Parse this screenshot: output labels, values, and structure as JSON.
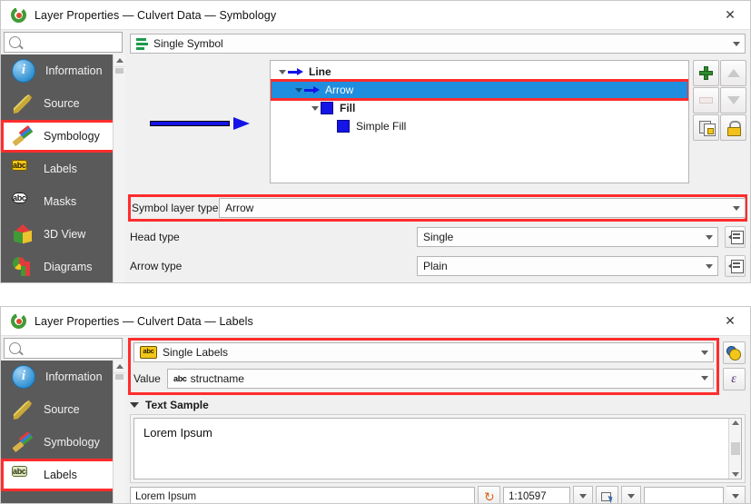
{
  "windows": {
    "symbology": {
      "title": "Layer Properties — Culvert Data — Symbology",
      "close_label": "✕",
      "search_placeholder": "",
      "search_value": "",
      "sidebar": [
        {
          "label": "Information",
          "icon": "info-icon",
          "active": false
        },
        {
          "label": "Source",
          "icon": "source-icon",
          "active": false
        },
        {
          "label": "Symbology",
          "icon": "symbology-brush-icon",
          "active": true
        },
        {
          "label": "Labels",
          "icon": "labels-abc-icon",
          "active": false
        },
        {
          "label": "Masks",
          "icon": "masks-abc-icon",
          "active": false
        },
        {
          "label": "3D View",
          "icon": "cube-3d-icon",
          "active": false
        },
        {
          "label": "Diagrams",
          "icon": "diagrams-chart-icon",
          "active": false
        }
      ],
      "renderer": {
        "label": "Single Symbol",
        "icon": "symbol-bars-icon"
      },
      "tree": [
        {
          "label": "Line",
          "indent": 0,
          "icon": "arrow-icon",
          "bold": true,
          "selected": false
        },
        {
          "label": "Arrow",
          "indent": 1,
          "icon": "arrow-icon",
          "bold": false,
          "selected": true
        },
        {
          "label": "Fill",
          "indent": 2,
          "icon": "color-swatch",
          "bold": true,
          "selected": false
        },
        {
          "label": "Simple Fill",
          "indent": 3,
          "icon": "color-swatch",
          "bold": false,
          "selected": false
        }
      ],
      "tree_buttons": [
        {
          "name": "add-symbol-layer-button",
          "icon": "plus-icon"
        },
        {
          "name": "move-up-button",
          "icon": "triangle-up-icon"
        },
        {
          "name": "remove-symbol-layer-button",
          "icon": "minus-icon"
        },
        {
          "name": "move-down-button",
          "icon": "triangle-down-icon"
        },
        {
          "name": "duplicate-button",
          "icon": "duplicate-icon"
        },
        {
          "name": "lock-button",
          "icon": "lock-icon"
        }
      ],
      "properties": [
        {
          "label": "Symbol layer type",
          "value": "Arrow",
          "highlighted": true,
          "has_override": false
        },
        {
          "label": "Head type",
          "value": "Single",
          "highlighted": false,
          "has_override": true
        },
        {
          "label": "Arrow type",
          "value": "Plain",
          "highlighted": false,
          "has_override": true
        }
      ],
      "symbol_color": "#1414e6",
      "highlight_color": "#ff2d2d",
      "selection_color": "#1f8ede"
    },
    "labels": {
      "title": "Layer Properties — Culvert Data — Labels",
      "close_label": "✕",
      "search_placeholder": "",
      "search_value": "",
      "sidebar": [
        {
          "label": "Information",
          "icon": "info-icon",
          "active": false
        },
        {
          "label": "Source",
          "icon": "source-icon",
          "active": false
        },
        {
          "label": "Symbology",
          "icon": "symbology-brush-icon",
          "active": false
        },
        {
          "label": "Labels",
          "icon": "labels-abc-icon",
          "active": true
        }
      ],
      "mode": {
        "label": "Single Labels",
        "icon": "labels-abc-icon"
      },
      "value_row": {
        "label": "Value",
        "field_icon": "abc-icon",
        "value": "structname"
      },
      "side_buttons": [
        {
          "name": "label-settings-button",
          "icon": "gear-icon"
        },
        {
          "name": "expression-button",
          "icon": "epsilon-icon",
          "glyph": "ε"
        }
      ],
      "text_sample": {
        "section_label": "Text Sample",
        "sample_text": "Lorem Ipsum",
        "input_value": "Lorem Ipsum",
        "revert_title": "↺",
        "scale_value": "1:10597",
        "blank_combo_value": ""
      },
      "highlight_color": "#ff2d2d"
    }
  }
}
